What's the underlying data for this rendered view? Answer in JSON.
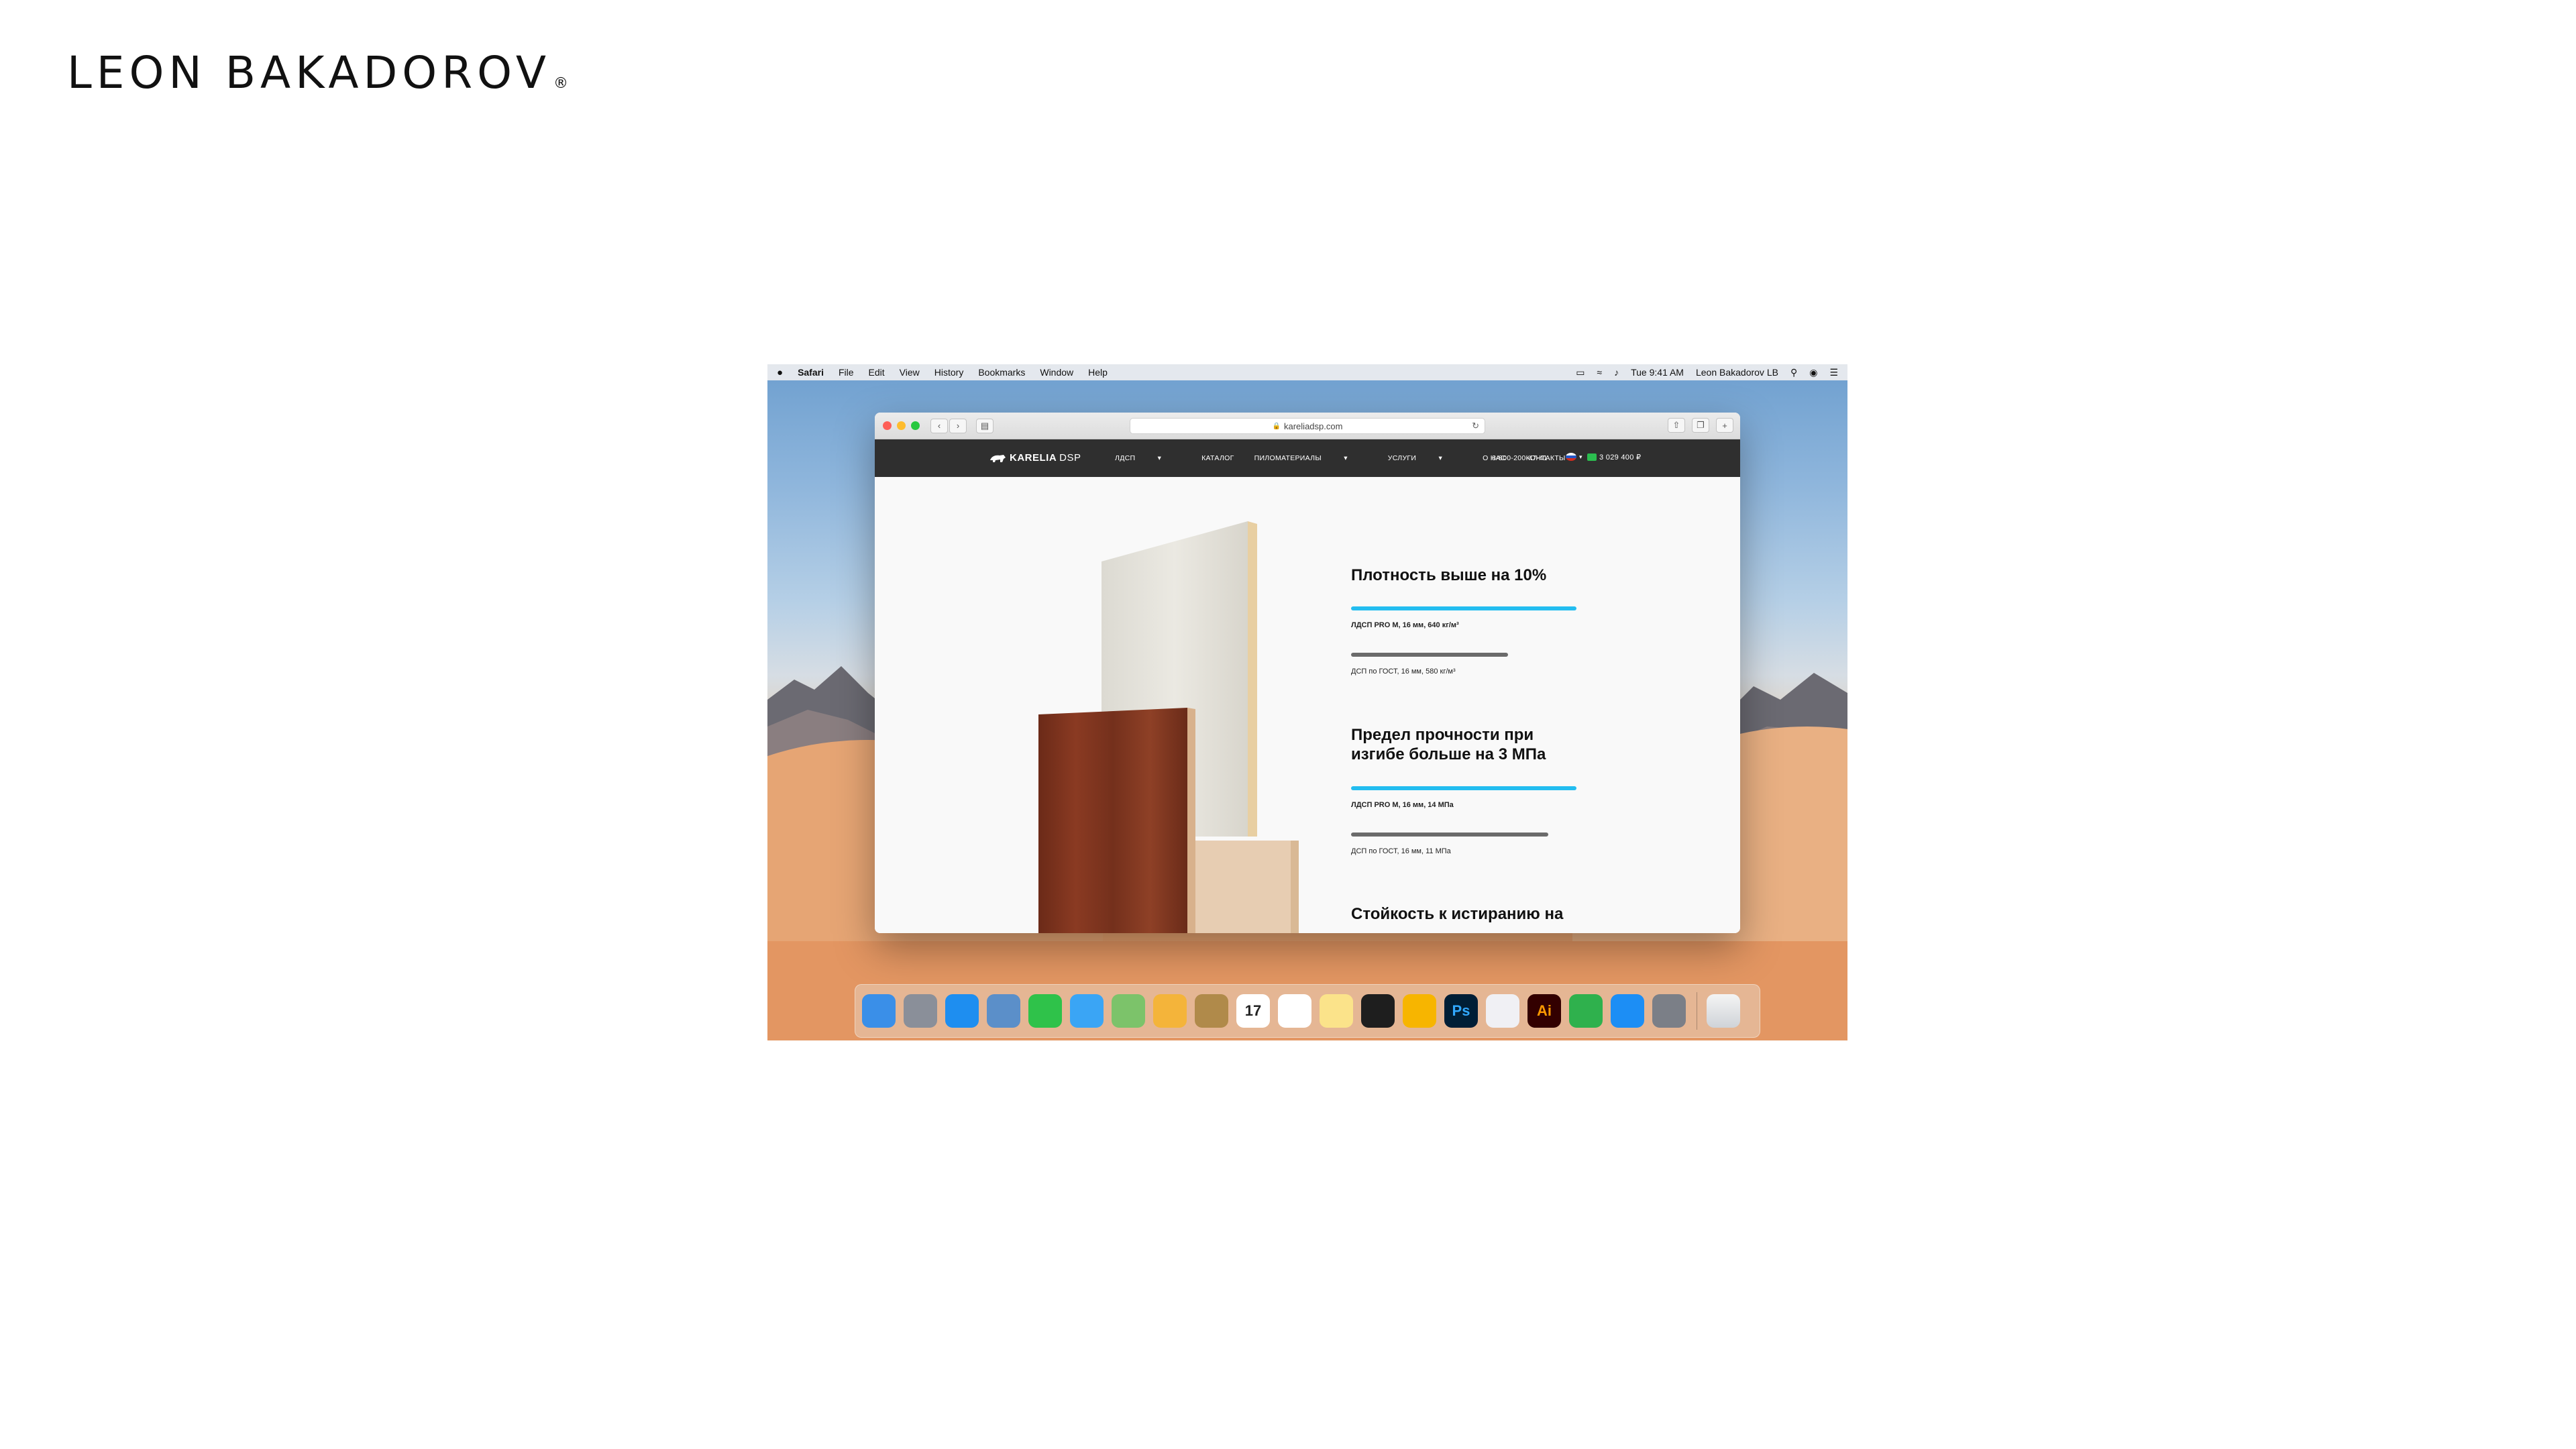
{
  "brand": {
    "name": "LEON BAKADOROV",
    "reg": "®"
  },
  "menubar": {
    "apple_icon": "apple-logo-icon",
    "app": "Safari",
    "items": [
      "File",
      "Edit",
      "View",
      "History",
      "Bookmarks",
      "Window",
      "Help"
    ],
    "time": "Tue 9:41 AM",
    "user": "Leon Bakadorov LB"
  },
  "browser": {
    "url": "kareliadsp.com",
    "lights": [
      "#fe5f57",
      "#febc2e",
      "#28c840"
    ]
  },
  "site": {
    "logo": {
      "bold": "KARELIA",
      "light": "DSP"
    },
    "nav": [
      "ЛДСП",
      "КАТАЛОГ",
      "ПИЛОМАТЕРИАЛЫ",
      "УСЛУГИ",
      "О НАС",
      "КОНТАКТЫ"
    ],
    "phone": "8-800-200-47-41",
    "cart": "3 029 400 ₽",
    "colors": {
      "nav_bg": "#2f2f2f",
      "accent": "#23bdf0",
      "secondary_bar": "#6b6b6b"
    },
    "stats": [
      {
        "title": "Плотность выше на 10%",
        "pro_label": "ЛДСП PRO M, 16 мм, 640 кг/м³",
        "pro_value": 640,
        "gost_label": "ДСП по ГОСТ, 16 мм, 580 кг/м³",
        "gost_value": 580
      },
      {
        "title": "Предел прочности при изгибе больше на 3 МПа",
        "pro_label": "ЛДСП PRO M, 16 мм, 14 МПа",
        "pro_value": 14,
        "gost_label": "ДСП по ГОСТ, 16 мм, 11 МПа",
        "gost_value": 11
      },
      {
        "title": "Стойкость к истиранию на"
      }
    ]
  },
  "dock": {
    "apps": [
      {
        "name": "finder-icon",
        "color": "#3a8fe8"
      },
      {
        "name": "launchpad-icon",
        "color": "#8a8f99"
      },
      {
        "name": "safari-icon",
        "color": "#1e8ef0"
      },
      {
        "name": "preview-icon",
        "color": "#5b8fc9"
      },
      {
        "name": "facetime-icon",
        "color": "#2fc24a"
      },
      {
        "name": "messages-icon",
        "color": "#3aa5f5"
      },
      {
        "name": "maps-icon",
        "color": "#7cc36a"
      },
      {
        "name": "photos-icon",
        "color": "#f4b43a"
      },
      {
        "name": "notefile-icon",
        "color": "#b08a4a"
      },
      {
        "name": "calendar-icon",
        "color": "#ffffff",
        "text": "17"
      },
      {
        "name": "reminders-icon",
        "color": "#ffffff"
      },
      {
        "name": "notes-icon",
        "color": "#fbe38a"
      },
      {
        "name": "figma-icon",
        "color": "#1e1e1e"
      },
      {
        "name": "sketch-icon",
        "color": "#f7b500"
      },
      {
        "name": "photoshop-icon",
        "color": "#001e36",
        "text": "Ps"
      },
      {
        "name": "itunes-icon",
        "color": "#f0f0f4"
      },
      {
        "name": "illustrator-icon",
        "color": "#330000",
        "text": "Ai"
      },
      {
        "name": "numbers-icon",
        "color": "#2fb14d"
      },
      {
        "name": "app-store-icon",
        "color": "#1c8ef5"
      },
      {
        "name": "system-preferences-icon",
        "color": "#7b7f87"
      }
    ],
    "trash": "trash-icon"
  }
}
